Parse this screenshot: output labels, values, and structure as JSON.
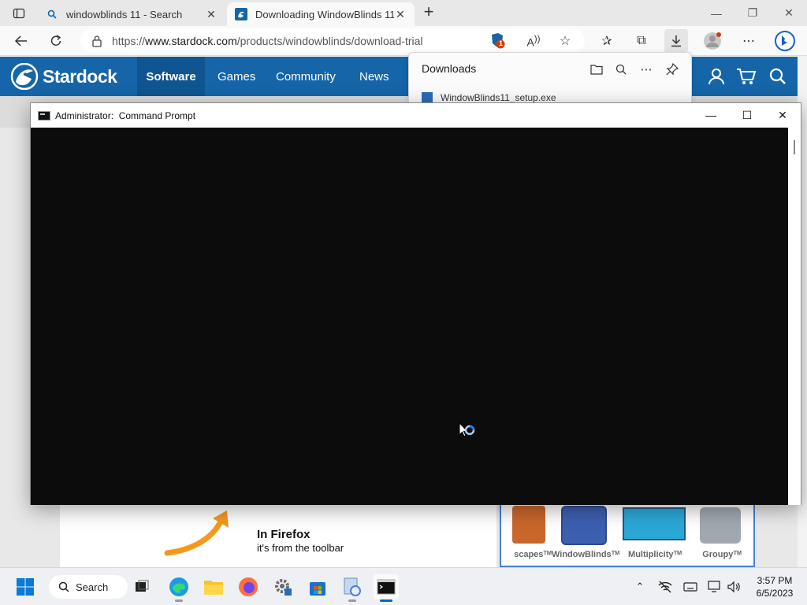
{
  "browser": {
    "tabs": [
      {
        "title": "windowblinds 11 - Search",
        "icon": "search-icon",
        "active": false
      },
      {
        "title": "Downloading WindowBlinds 11 (",
        "icon": "stardock-favicon",
        "active": true
      }
    ],
    "new_tab_label": "+",
    "address": {
      "url_prefix": "https://",
      "url_domain": "www.stardock.com",
      "url_path": "/products/windowblinds/download-trial"
    },
    "badge_count": "1"
  },
  "downloads": {
    "title": "Downloads",
    "file_name": "WindowBlinds11_setup.exe"
  },
  "site": {
    "brand": "Stardock",
    "nav": [
      {
        "label": "Software",
        "active": true
      },
      {
        "label": "Games",
        "active": false
      },
      {
        "label": "Community",
        "active": false
      },
      {
        "label": "News",
        "active": false
      }
    ],
    "promo": {
      "heading": "In Firefox",
      "subtext": "it's from the toolbar"
    },
    "products": [
      "scapesᵀᴹ",
      "WindowBlindsᵀᴹ",
      "Multiplicityᵀᴹ",
      "Groupyᵀᴹ"
    ]
  },
  "cmd_window": {
    "title": "Administrator:  Command Prompt"
  },
  "taskbar": {
    "search_label": "Search",
    "time": "3:57 PM",
    "date": "6/5/2023"
  },
  "colors": {
    "stardock_blue": "#1565a8",
    "console_bg": "#0c0c0c",
    "accent": "#0067c0"
  }
}
